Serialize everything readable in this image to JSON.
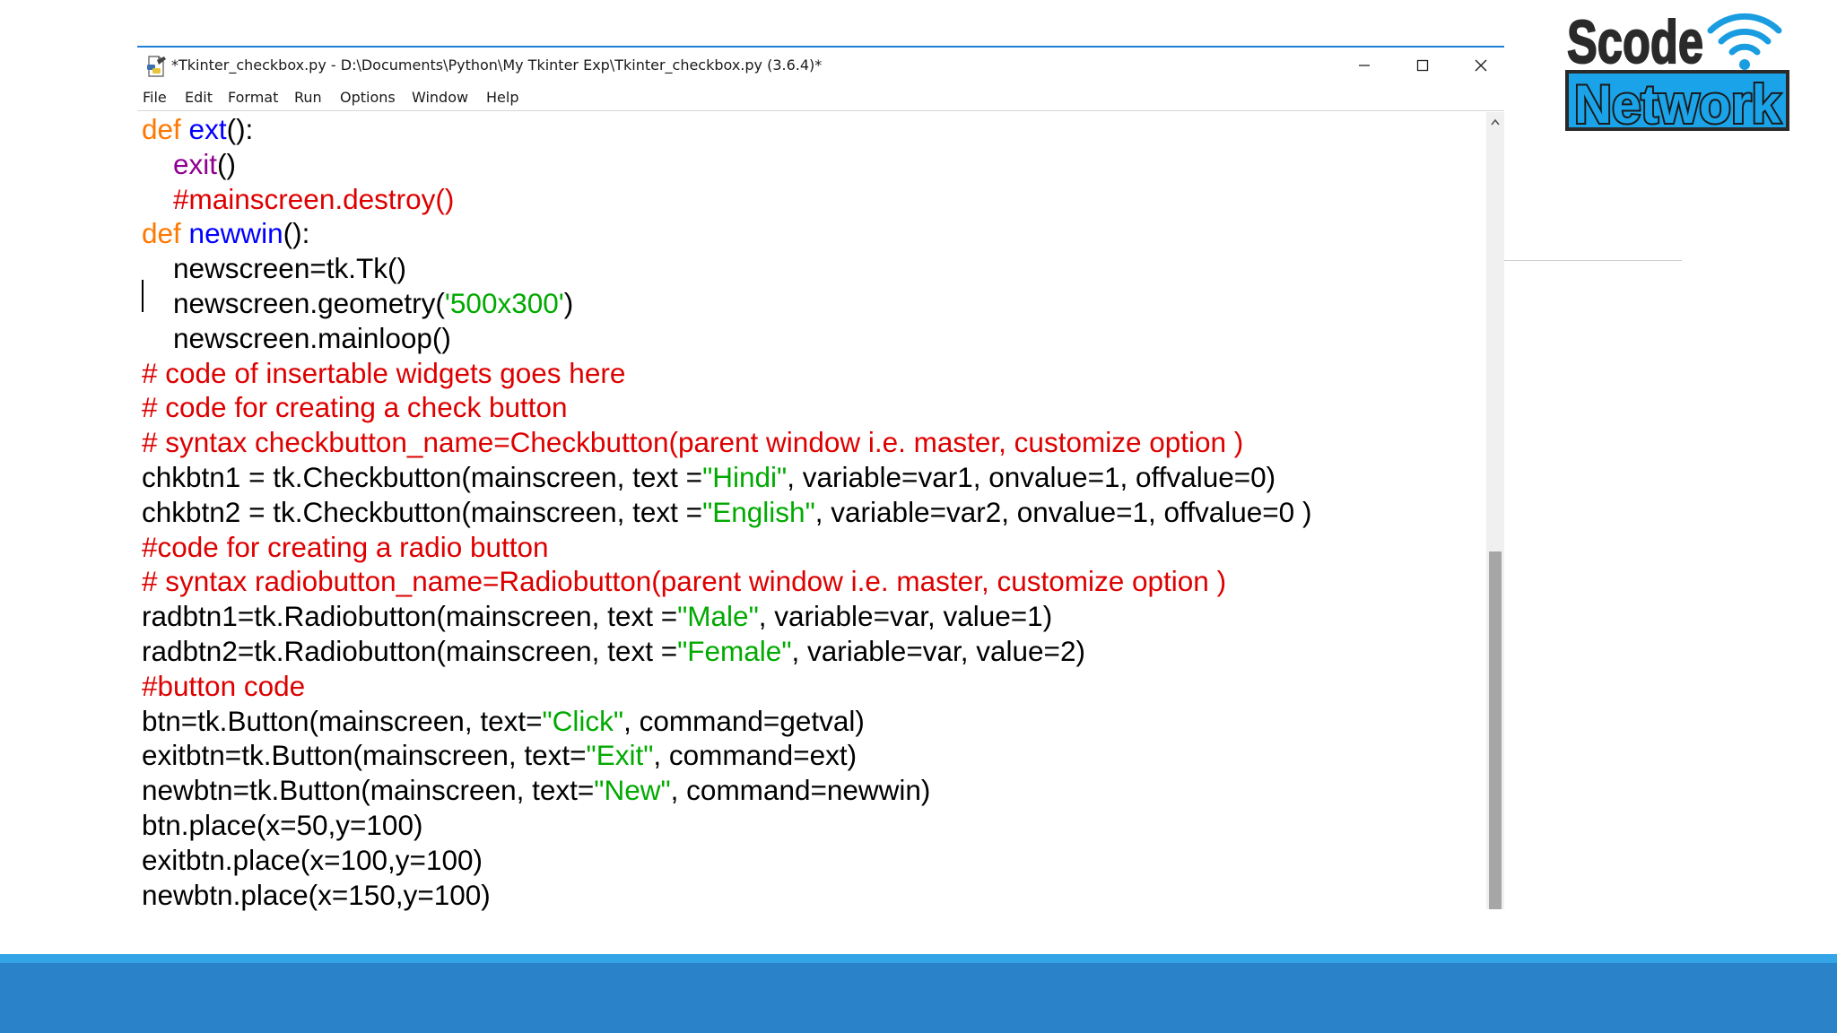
{
  "window": {
    "title": "*Tkinter_checkbox.py - D:\\Documents\\Python\\My Tkinter Exp\\Tkinter_checkbox.py (3.6.4)*",
    "icon": "python-file-icon",
    "controls": {
      "minimize": "minimize-icon",
      "maximize": "maximize-icon",
      "close": "close-icon"
    }
  },
  "menu": [
    "File",
    "Edit",
    "Format",
    "Run",
    "Options",
    "Window",
    "Help"
  ],
  "editor": {
    "lines": [
      [
        {
          "t": "def ",
          "c": "kw"
        },
        {
          "t": "ext",
          "c": "fn"
        },
        {
          "t": "():",
          "c": ""
        }
      ],
      [
        {
          "t": "    ",
          "c": ""
        },
        {
          "t": "exit",
          "c": "bi"
        },
        {
          "t": "()",
          "c": ""
        }
      ],
      [
        {
          "t": "    #mainscreen.destroy()",
          "c": "cm"
        }
      ],
      [
        {
          "t": "def ",
          "c": "kw"
        },
        {
          "t": "newwin",
          "c": "fn"
        },
        {
          "t": "():",
          "c": ""
        }
      ],
      [
        {
          "t": "    newscreen=tk.Tk()",
          "c": ""
        }
      ],
      [
        {
          "t": "    newscreen.geometry(",
          "c": ""
        },
        {
          "t": "'500x300'",
          "c": "st"
        },
        {
          "t": ")",
          "c": ""
        }
      ],
      [
        {
          "t": "    newscreen.mainloop()",
          "c": ""
        }
      ],
      [
        {
          "t": "# code of insertable widgets goes here",
          "c": "cm"
        }
      ],
      [
        {
          "t": "# code for creating a check button",
          "c": "cm"
        }
      ],
      [
        {
          "t": "# syntax checkbutton_name=Checkbutton(parent window i.e. master, customize option )",
          "c": "cm"
        }
      ],
      [
        {
          "t": "chkbtn1 = tk.Checkbutton(mainscreen, text =",
          "c": ""
        },
        {
          "t": "\"Hindi\"",
          "c": "st"
        },
        {
          "t": ", variable=var1, onvalue=1, offvalue=0)",
          "c": ""
        }
      ],
      [
        {
          "t": "chkbtn2 = tk.Checkbutton(mainscreen, text =",
          "c": ""
        },
        {
          "t": "\"English\"",
          "c": "st"
        },
        {
          "t": ", variable=var2, onvalue=1, offvalue=0 )",
          "c": ""
        }
      ],
      [
        {
          "t": "#code for creating a radio button",
          "c": "cm"
        }
      ],
      [
        {
          "t": "# syntax radiobutton_name=Radiobutton(parent window i.e. master, customize option )",
          "c": "cm"
        }
      ],
      [
        {
          "t": "radbtn1=tk.Radiobutton(mainscreen, text =",
          "c": ""
        },
        {
          "t": "\"Male\"",
          "c": "st"
        },
        {
          "t": ", variable=var, value=1)",
          "c": ""
        }
      ],
      [
        {
          "t": "radbtn2=tk.Radiobutton(mainscreen, text =",
          "c": ""
        },
        {
          "t": "\"Female\"",
          "c": "st"
        },
        {
          "t": ", variable=var, value=2)",
          "c": ""
        }
      ],
      [
        {
          "t": "#button code",
          "c": "cm"
        }
      ],
      [
        {
          "t": "btn=tk.Button(mainscreen, text=",
          "c": ""
        },
        {
          "t": "\"Click\"",
          "c": "st"
        },
        {
          "t": ", command=getval)",
          "c": ""
        }
      ],
      [
        {
          "t": "exitbtn=tk.Button(mainscreen, text=",
          "c": ""
        },
        {
          "t": "\"Exit\"",
          "c": "st"
        },
        {
          "t": ", command=ext)",
          "c": ""
        }
      ],
      [
        {
          "t": "newbtn=tk.Button(mainscreen, text=",
          "c": ""
        },
        {
          "t": "\"New\"",
          "c": "st"
        },
        {
          "t": ", command=newwin)",
          "c": ""
        }
      ],
      [
        {
          "t": "btn.place(x=50,y=100)",
          "c": ""
        }
      ],
      [
        {
          "t": "exitbtn.place(x=100,y=100)",
          "c": ""
        }
      ],
      [
        {
          "t": "newbtn.place(x=150,y=100)",
          "c": ""
        }
      ]
    ]
  },
  "logo": {
    "line1": "Scode",
    "line2": "Network",
    "icon": "wifi-icon"
  },
  "colors": {
    "keyword": "#ff7700",
    "function": "#0000ff",
    "builtin": "#900090",
    "comment": "#dd0000",
    "string": "#00aa00",
    "footer": "#2a83c9",
    "footer_light": "#33a4e6"
  }
}
